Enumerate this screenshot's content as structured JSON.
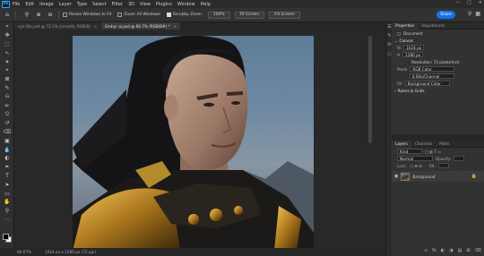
{
  "menubar": {
    "logo": "Ps",
    "items": [
      "File",
      "Edit",
      "Image",
      "Layer",
      "Type",
      "Select",
      "Filter",
      "3D",
      "View",
      "Plugins",
      "Window",
      "Help"
    ]
  },
  "options": {
    "checkboxes": [
      {
        "label": "Resize Windows to Fit",
        "checked": false
      },
      {
        "label": "Zoom All Windows",
        "checked": false
      },
      {
        "label": "Scrubby Zoom",
        "checked": true
      }
    ],
    "buttons": [
      "100%",
      "Fit Screen",
      "Fill Screen"
    ],
    "share_label": "Share"
  },
  "tabs": [
    {
      "label": "vye Ste.psd @ 72.1% (smooth, RGB/8)",
      "active": false
    },
    {
      "label": "Emhyr ai.psd @ 66.7% (RGB/8#) *",
      "active": true
    }
  ],
  "status": {
    "zoom": "66.67%",
    "doc_info": "1024 px x 1280 px (72 ppi)"
  },
  "properties": {
    "tabs": [
      "Properties",
      "Adjustments"
    ],
    "kind": "Document",
    "canvas_title": "Canvas",
    "w_label": "W",
    "w_value": "1024 px",
    "h_label": "H",
    "h_value": "1280 px",
    "resolution": "Resolution: 72 pixels/inch",
    "mode_label": "Mode",
    "mode_value": "RGB Color",
    "bits_value": "8 Bits/Channel",
    "fill_label": "Fill",
    "fill_value": "Background Color",
    "next_section": "Rulers & Grids"
  },
  "layers": {
    "tabs": [
      "Layers",
      "Channels",
      "Paths"
    ],
    "kind_label": "Kind",
    "blend_mode": "Normal",
    "opacity_label": "Opacity:",
    "lock_label": "Lock:",
    "fill_label": "Fill:",
    "layer_name": "Background"
  },
  "colors": {
    "accent": "#1473e6",
    "panel_bg": "#323232",
    "app_bg": "#262626"
  }
}
